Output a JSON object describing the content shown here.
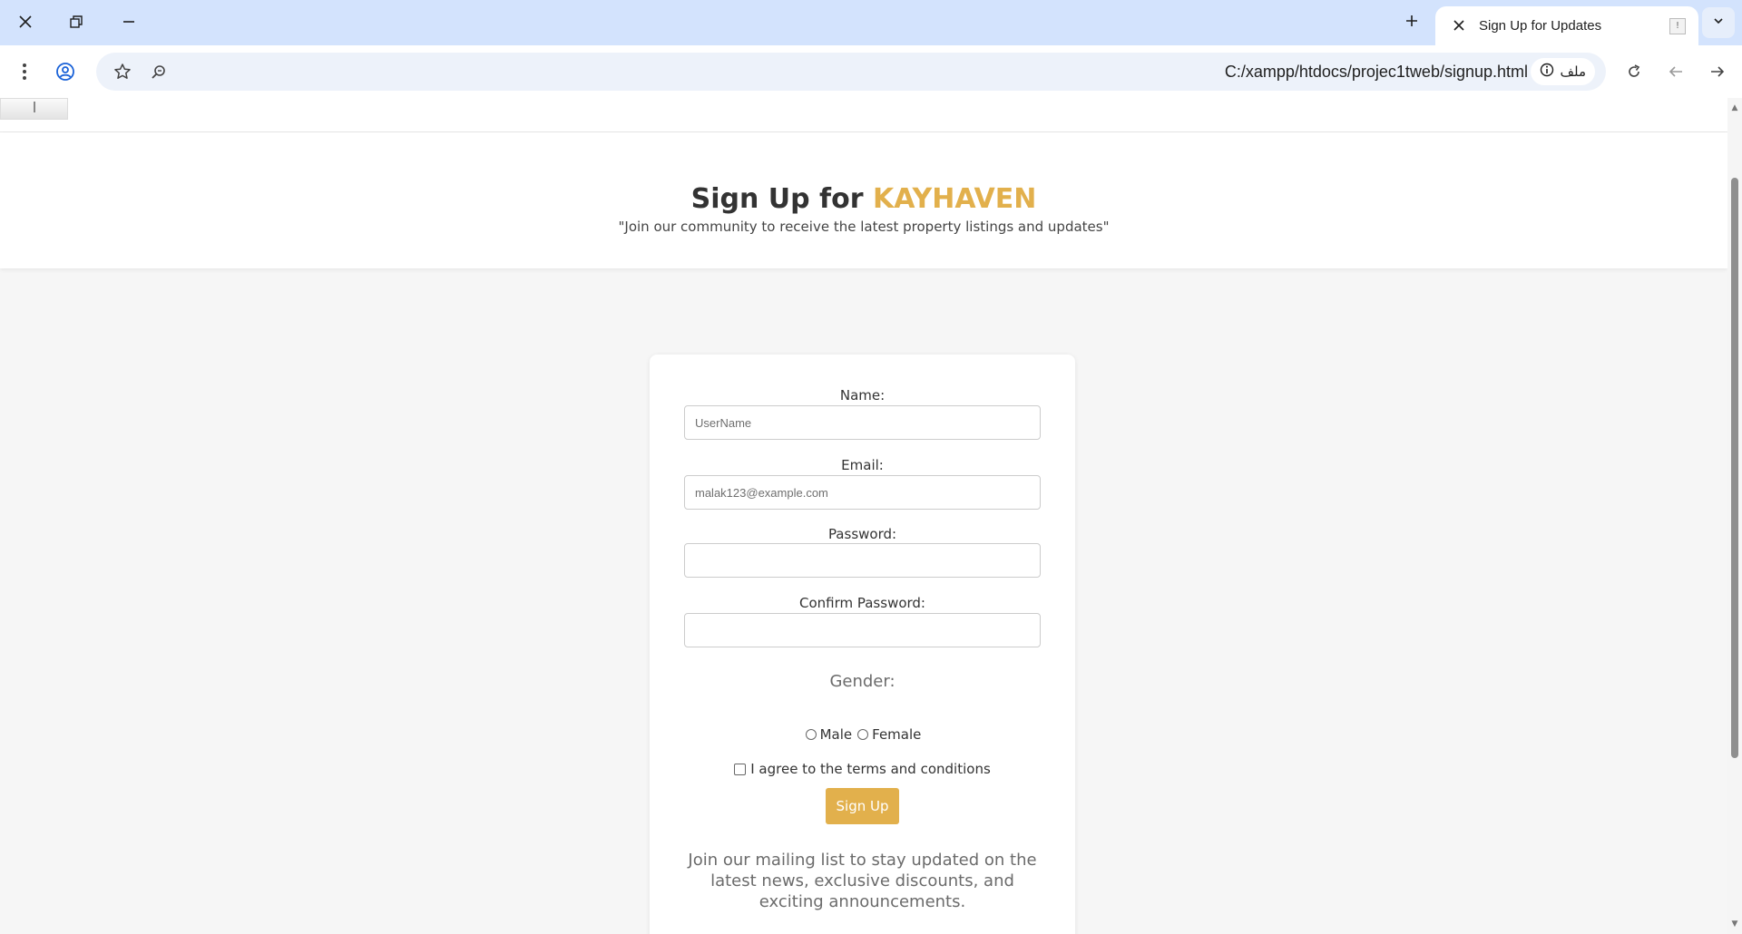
{
  "browser": {
    "tab_title": "Sign Up for Updates",
    "address_url": "C:/xampp/htdocs/projec1tweb/signup.html",
    "site_chip_label": "ملف",
    "icons": [
      "close-window-icon",
      "restore-window-icon",
      "minimize-window-icon",
      "new-tab-icon",
      "tab-close-icon",
      "tab-list-icon",
      "menu-icon",
      "profile-icon",
      "bookmark-star-icon",
      "zoom-icon",
      "info-icon",
      "reload-icon",
      "back-icon",
      "forward-icon"
    ]
  },
  "page": {
    "heading_prefix": "Sign Up for",
    "heading_brand": "KAYHAVEN",
    "subtitle": "\"Join our community to receive the latest property listings and updates\"",
    "brand_color": "#e2b04c"
  },
  "form": {
    "name_label": "Name:",
    "name_placeholder": "UserName",
    "email_label": "Email:",
    "email_placeholder": "malak123@example.com",
    "password_label": "Password:",
    "confirm_label": "Confirm Password:",
    "gender_label": "Gender:",
    "male_label": "Male",
    "female_label": "Female",
    "terms_label": "I agree to the terms and conditions",
    "submit_label": "Sign Up",
    "mailing_text": "Join our mailing list to stay updated on the latest news, exclusive discounts, and exciting announcements."
  }
}
